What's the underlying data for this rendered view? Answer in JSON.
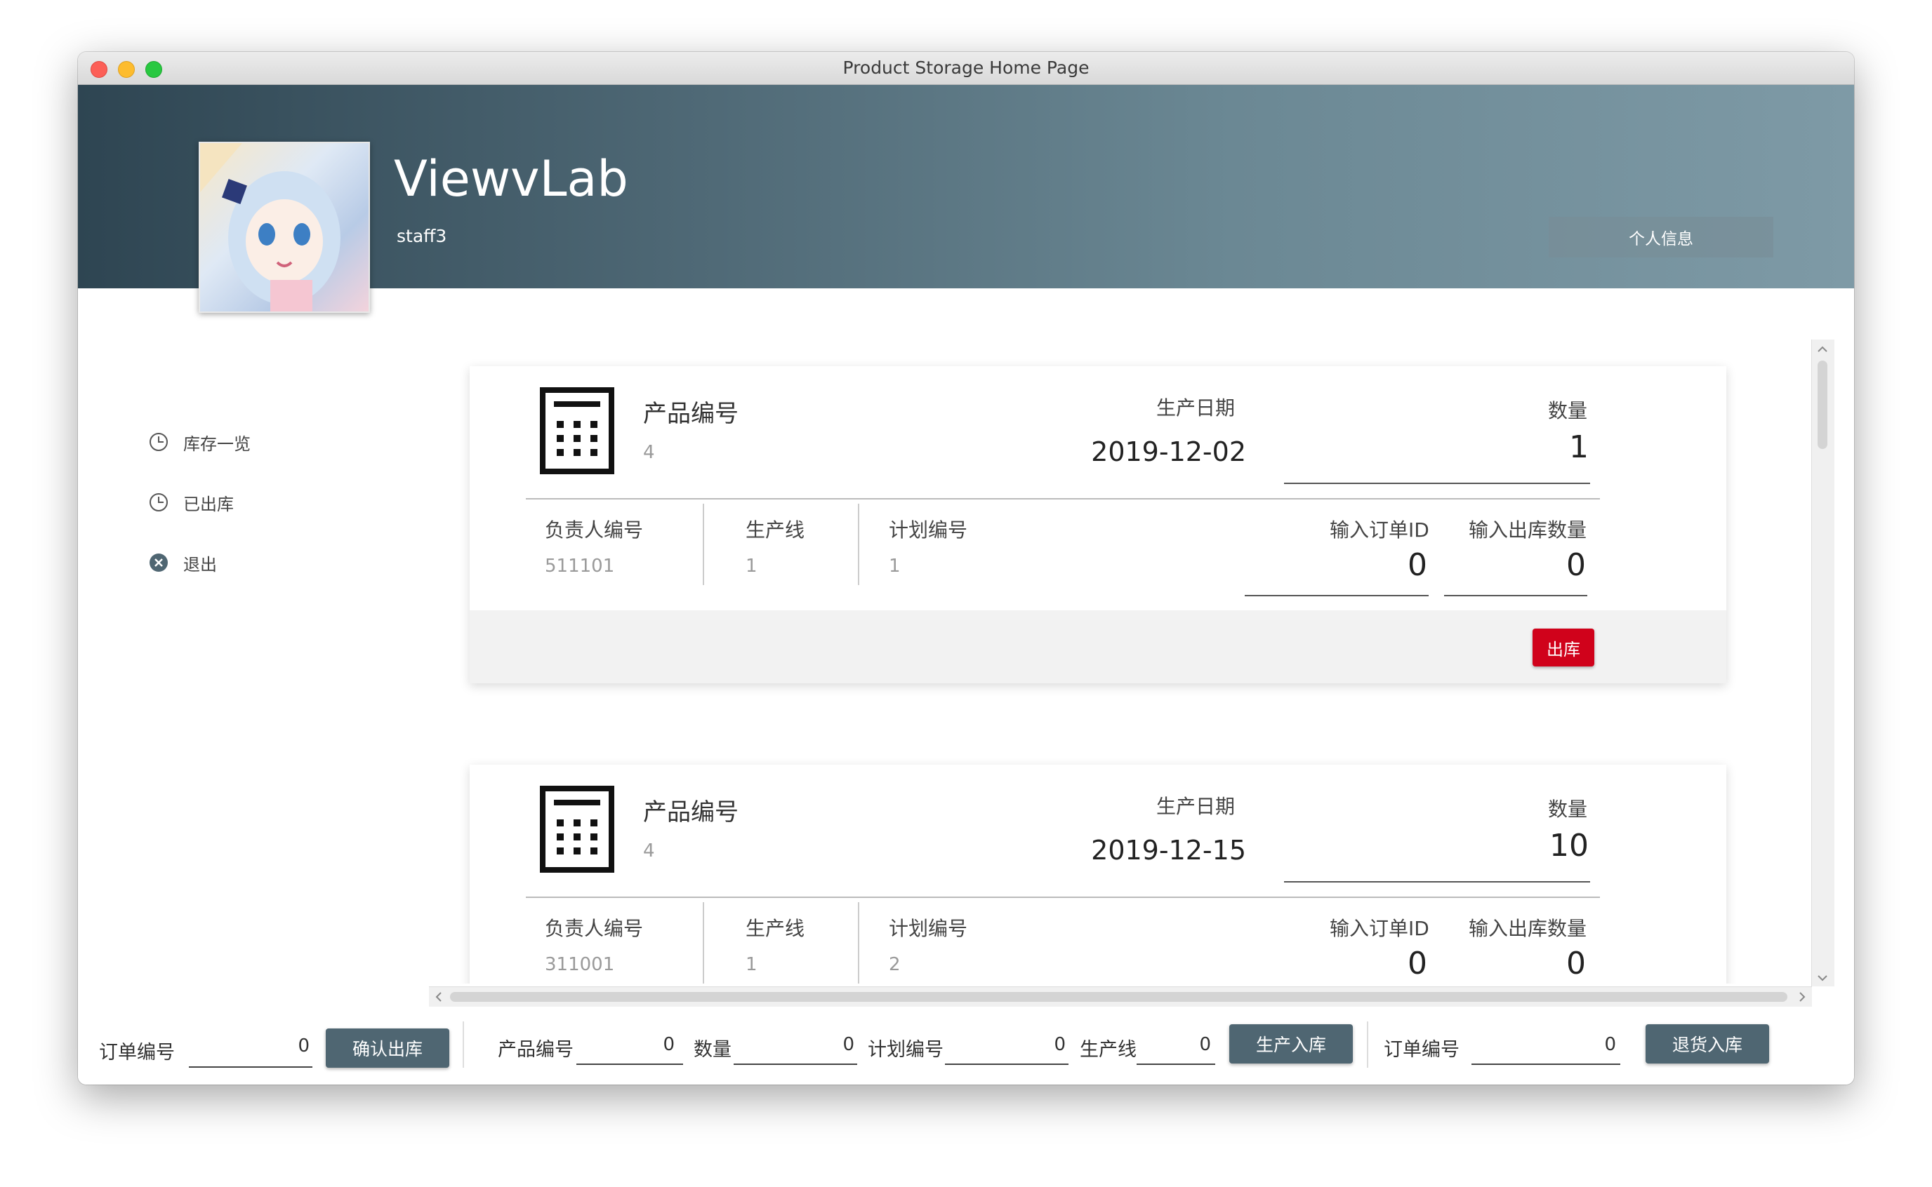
{
  "window": {
    "title": "Product Storage Home Page"
  },
  "header": {
    "app_name": "ViewvLab",
    "user_id": "staff3",
    "profile_button": "个人信息"
  },
  "sidebar": {
    "items": [
      {
        "label": "库存一览",
        "icon": "clock-icon"
      },
      {
        "label": "已出库",
        "icon": "clock-icon"
      },
      {
        "label": "退出",
        "icon": "close-circle-icon"
      }
    ]
  },
  "labels": {
    "product_no": "产品编号",
    "production_date": "生产日期",
    "quantity": "数量",
    "manager_no": "负责人编号",
    "production_line": "生产线",
    "plan_no": "计划编号",
    "input_order_id": "输入订单ID",
    "input_out_qty": "输入出库数量",
    "out_button": "出库"
  },
  "cards": [
    {
      "product_no": "4",
      "production_date": "2019-12-02",
      "quantity": "1",
      "manager_no": "511101",
      "production_line": "1",
      "plan_no": "1",
      "order_id_input": "0",
      "out_qty_input": "0"
    },
    {
      "product_no": "4",
      "production_date": "2019-12-15",
      "quantity": "10",
      "manager_no": "311001",
      "production_line": "1",
      "plan_no": "2",
      "order_id_input": "0",
      "out_qty_input": "0"
    }
  ],
  "bottom_bar": {
    "confirm_out": {
      "order_label": "订单编号",
      "order_value": "0",
      "button": "确认出库"
    },
    "produce_in": {
      "product_label": "产品编号",
      "product_value": "0",
      "qty_label": "数量",
      "qty_value": "0",
      "plan_label": "计划编号",
      "plan_value": "0",
      "line_label": "生产线",
      "line_value": "0",
      "button": "生产入库"
    },
    "return_in": {
      "order_label": "订单编号",
      "order_value": "0",
      "button": "退货入库"
    }
  },
  "colors": {
    "out_button": "#d0021b",
    "action_button": "#4f6672",
    "header_start": "#2e4552",
    "header_end": "#7e9aa6"
  }
}
